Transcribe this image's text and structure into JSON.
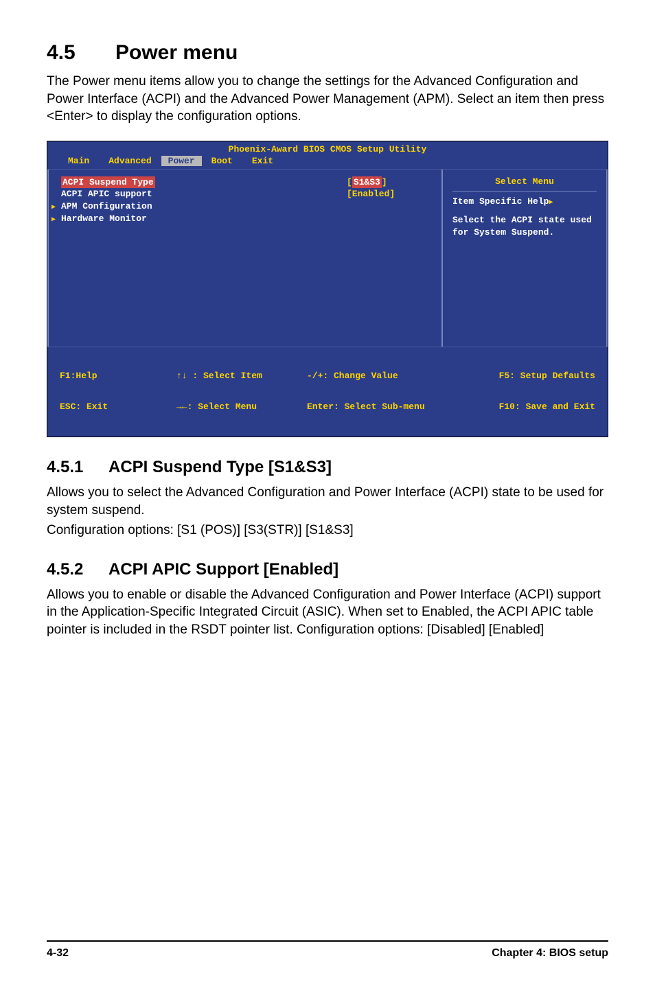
{
  "heading": {
    "num": "4.5",
    "title": "Power menu"
  },
  "intro": "The Power menu items allow you to change the settings for the Advanced Configuration and Power Interface (ACPI) and the Advanced Power Management (APM). Select an item then press <Enter> to display the configuration options.",
  "bios": {
    "title": "Phoenix-Award BIOS CMOS Setup Utility",
    "tabs": [
      "Main",
      "Advanced",
      "Power",
      "Boot",
      "Exit"
    ],
    "active_tab": "Power",
    "items": [
      {
        "label": "ACPI Suspend Type",
        "value": "[S1&S3]",
        "highlighted": true
      },
      {
        "label": "ACPI APIC support",
        "value": "[Enabled]"
      },
      {
        "label": "APM Configuration",
        "submenu": true
      },
      {
        "label": "Hardware Monitor",
        "submenu": true
      }
    ],
    "help": {
      "title": "Select Menu",
      "line1": "Item Specific Help",
      "body": "Select the ACPI state used for System Suspend."
    },
    "footer": {
      "f1": "F1:Help",
      "esc": "ESC: Exit",
      "sel_item": "↑↓ : Select Item",
      "sel_menu": "→←: Select Menu",
      "change": "-/+: Change Value",
      "enter": "Enter: Select Sub-menu",
      "f5": "F5: Setup Defaults",
      "f10": "F10: Save and Exit"
    }
  },
  "s451": {
    "num": "4.5.1",
    "title": "ACPI Suspend Type [S1&S3]",
    "p1": "Allows you to select the Advanced Configuration and Power Interface (ACPI) state to be used for system suspend.",
    "p2": "Configuration options: [S1 (POS)] [S3(STR)] [S1&S3]"
  },
  "s452": {
    "num": "4.5.2",
    "title": "ACPI APIC Support [Enabled]",
    "p1": "Allows you to enable or disable the Advanced Configuration and Power Interface (ACPI) support in the Application-Specific Integrated Circuit (ASIC). When set to Enabled, the ACPI APIC table pointer is included in the RSDT pointer list. Configuration options: [Disabled] [Enabled]"
  },
  "footer": {
    "left": "4-32",
    "right": "Chapter 4: BIOS setup"
  }
}
